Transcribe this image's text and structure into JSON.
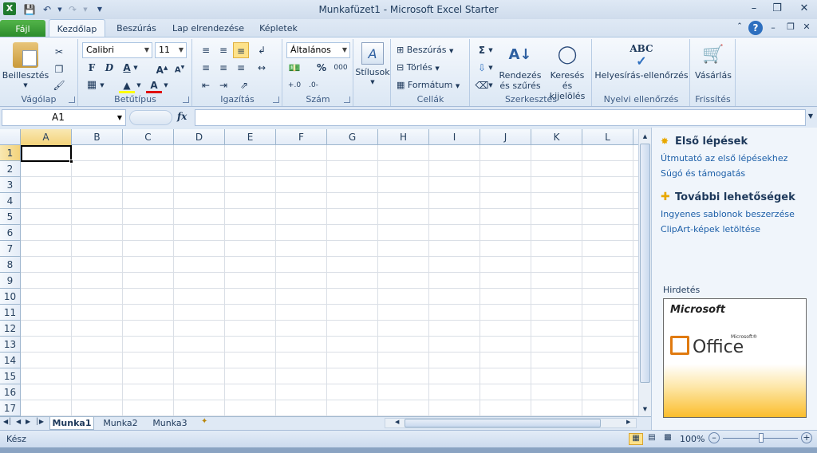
{
  "window": {
    "title": "Munkafüzet1  -  Microsoft Excel Starter"
  },
  "tabs": [
    "Fájl",
    "Kezdőlap",
    "Beszúrás",
    "Lap elrendezése",
    "Képletek"
  ],
  "ribbon": {
    "clipboard": {
      "label": "Vágólap",
      "paste": "Beillesztés"
    },
    "font": {
      "label": "Betűtípus",
      "name": "Calibri",
      "size": "11",
      "bold": "F",
      "italic": "D",
      "underline": "A"
    },
    "alignment": {
      "label": "Igazítás"
    },
    "number": {
      "label": "Szám",
      "format": "Általános",
      "percent": "%",
      "thousands": "000"
    },
    "styles": {
      "label": "Stílusok"
    },
    "cells": {
      "label": "Cellák",
      "insert": "Beszúrás",
      "delete": "Törlés",
      "format": "Formátum"
    },
    "editing": {
      "label": "Szerkesztés",
      "sort1": "Rendezés",
      "sort2": "és szűrés",
      "find1": "Keresés és",
      "find2": "kijelölés"
    },
    "proofing": {
      "label": "Nyelvi ellenőrzés",
      "spell": "Helyesírás-ellenőrzés",
      "abc": "ABC"
    },
    "updates": {
      "label": "Frissítés",
      "buy": "Vásárlás"
    }
  },
  "formula_bar": {
    "cell": "A1",
    "fx": "fx",
    "value": ""
  },
  "grid": {
    "columns": [
      "A",
      "B",
      "C",
      "D",
      "E",
      "F",
      "G",
      "H",
      "I",
      "J",
      "K",
      "L"
    ],
    "rows": [
      "1",
      "2",
      "3",
      "4",
      "5",
      "6",
      "7",
      "8",
      "9",
      "10",
      "11",
      "12",
      "13",
      "14",
      "15",
      "16",
      "17"
    ]
  },
  "sheets": [
    "Munka1",
    "Munka2",
    "Munka3"
  ],
  "status": {
    "ready": "Kész",
    "zoom": "100%"
  },
  "side_pane": {
    "first_title": "Első lépések",
    "first_links": [
      "Útmutató az első lépésekhez",
      "Súgó és támogatás"
    ],
    "more_title": "További lehetőségek",
    "more_links": [
      "Ingyenes sablonok beszerzése",
      "ClipArt-képek letöltése"
    ],
    "ad_label": "Hirdetés",
    "ad_brand": "Microsoft",
    "ad_product": "Office",
    "ad_small": "Microsoft®"
  },
  "colors": {
    "accent": "#1e395b",
    "file_tab": "#2a8a2a",
    "link": "#1c5fa8"
  }
}
